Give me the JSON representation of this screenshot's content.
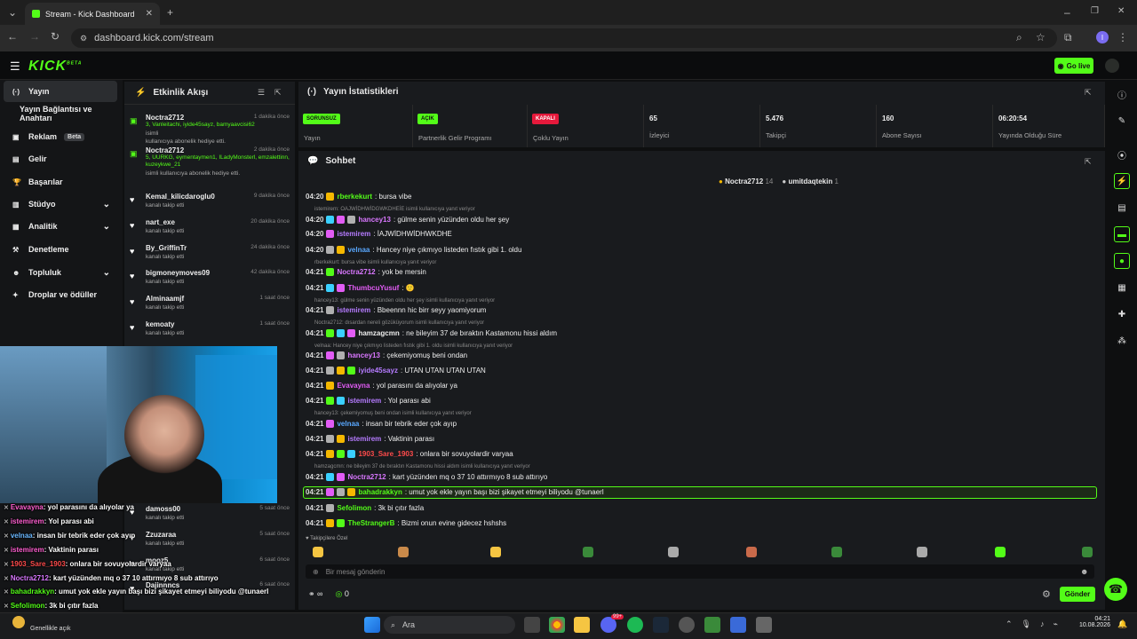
{
  "browser": {
    "tab_title": "Stream - Kick Dashboard",
    "url": "dashboard.kick.com/stream",
    "profile_initial": "I"
  },
  "app": {
    "logo": "KICK",
    "logo_sup": "BETA",
    "go_live": "Go live"
  },
  "sidebar": {
    "items": [
      {
        "label": "Yayın",
        "icon": "broadcast-icon",
        "active": true
      },
      {
        "label": "Yayın Bağlantısı ve Anahtarı"
      },
      {
        "label": "Reklam",
        "icon": "ad-icon",
        "badge": "Beta"
      },
      {
        "label": "Gelir",
        "icon": "money-icon"
      },
      {
        "label": "Başarılar",
        "icon": "trophy-icon"
      },
      {
        "label": "Stüdyo",
        "icon": "studio-icon"
      },
      {
        "label": "Analitik",
        "icon": "chart-icon"
      },
      {
        "label": "Denetleme",
        "icon": "hammer-icon"
      },
      {
        "label": "Topluluk",
        "icon": "users-icon"
      },
      {
        "label": "Droplar ve ödüller",
        "icon": "gift-icon"
      }
    ]
  },
  "feed": {
    "title": "Etkinlik Akışı",
    "items": [
      {
        "user": "Noctra2712",
        "time": "1 dakika önce",
        "green": "3, Vanleitachi, iyide45sayz, bamyaavcisi62",
        "sub": "kullanıcıya abonelik hediye etti.",
        "sub_prefix": "isimli"
      },
      {
        "user": "Noctra2712",
        "time": "2 dakika önce",
        "green": "5, UURKG, eymentaymen1, ILadyMonsterl, emzalettinn, kuzeykwe_21",
        "sub": "isimli kullanıcıya abonelik hediye etti."
      },
      {
        "user": "Kemal_kilicdaroglu0",
        "time": "9 dakika önce",
        "sub": "kanalı takip etti"
      },
      {
        "user": "nart_exe",
        "time": "20 dakika önce",
        "sub": "kanalı takip etti"
      },
      {
        "user": "By_GriffinTr",
        "time": "24 dakika önce",
        "sub": "kanalı takip etti"
      },
      {
        "user": "bigmoneymoves09",
        "time": "42 dakika önce",
        "sub": "kanalı takip etti"
      },
      {
        "user": "Alminaamjf",
        "time": "1 saat önce",
        "sub": "kanalı takip etti"
      },
      {
        "user": "kemoaty",
        "time": "1 saat önce",
        "sub": "kanalı takip etti"
      },
      {
        "user": "damoss00",
        "time": "5 saat önce",
        "sub": "kanalı takip etti"
      },
      {
        "user": "Zzuzaraa",
        "time": "5 saat önce",
        "sub": "kanalı takip etti"
      },
      {
        "user": "mooz5",
        "time": "6 saat önce",
        "sub": "kanalı takip etti"
      },
      {
        "user": "Dajinnncs",
        "time": "6 saat önce",
        "sub": ""
      }
    ]
  },
  "stats": {
    "title": "Yayın İstatistikleri",
    "cells": [
      {
        "pill": "SORUNSUZ",
        "label": "Yayın",
        "pill_color": "#53fc18"
      },
      {
        "pill": "AÇIK",
        "label": "Partnerlik Gelir Programı",
        "pill_color": "#53fc18"
      },
      {
        "pill": "KAPALI",
        "label": "Çoklu Yayın",
        "pill_color": "#e5193b"
      },
      {
        "value": "65",
        "label": "İzleyici"
      },
      {
        "value": "5.476",
        "label": "Takipçi"
      },
      {
        "value": "160",
        "label": "Abone Sayısı"
      },
      {
        "value": "06:20:54",
        "label": "Yayında Olduğu Süre"
      }
    ]
  },
  "chat": {
    "title": "Sohbet",
    "pinned": [
      {
        "user": "Noctra2712",
        "count": "14"
      },
      {
        "user": "umitdaqtekin",
        "count": "1"
      }
    ],
    "lines": [
      {
        "t": "04:20",
        "u": "rberkekurt",
        "c": "#53fc18",
        "m": ": bursa vibe"
      },
      {
        "reply": "istemirem: OAJWİDHWİDGWKDHEİE isimli kullanıcıya yanıt veriyor"
      },
      {
        "t": "04:20",
        "u": "hancey13",
        "c": "#d977ff",
        "m": ": gülme senin yüzünden oldu her şey"
      },
      {
        "t": "04:20",
        "u": "istemirem",
        "c": "#b57bff",
        "m": ": İAJWİDHWİDHWKDHE"
      },
      {
        "t": "04:20",
        "u": "velnaa",
        "c": "#59a8ff",
        "m": ": Hancey niye çıkmıyo listeden fıstık gibi 1. oldu"
      },
      {
        "reply": "rberkekurt: bursa vibe isimli kullanıcıya yanıt veriyor"
      },
      {
        "t": "04:21",
        "u": "Noctra2712",
        "c": "#d977ff",
        "m": ": yok be mersin"
      },
      {
        "t": "04:21",
        "u": "ThumbcuYusuf",
        "c": "#e25cf5",
        "m": ": 🙂"
      },
      {
        "reply": "hancey13: gülme senin yüzünden oldu her şey isimli kullanıcıya yanıt veriyor"
      },
      {
        "t": "04:21",
        "u": "istemirem",
        "c": "#b57bff",
        "m": ": Bbeennn hic birr seyy yaomiyorum"
      },
      {
        "reply": "Noctra2712: dısardan nereli gözüküyorum isimli kullanıcıya yanıt veriyor"
      },
      {
        "t": "04:21",
        "u": "hamzagcmn",
        "c": "#eeeeee",
        "m": ": ne bileyim 37 de bıraktın Kastamonu hissi aldım"
      },
      {
        "reply": "velnaa: Hancey niye çıkmıyo listeden fıstık gibi 1. oldu isimli kullanıcıya yanıt veriyor"
      },
      {
        "t": "04:21",
        "u": "hancey13",
        "c": "#d977ff",
        "m": ": çekemiyomuş beni ondan"
      },
      {
        "t": "04:21",
        "u": "iyide45sayz",
        "c": "#b57bff",
        "m": ": UTAN UTAN UTAN UTAN"
      },
      {
        "t": "04:21",
        "u": "Evavayna",
        "c": "#e25cf5",
        "m": ": yol parasını da alıyolar ya"
      },
      {
        "t": "04:21",
        "u": "istemirem",
        "c": "#b57bff",
        "m": ": Yol parası abi"
      },
      {
        "reply": "hancey13: çekemiyomuş beni ondan isimli kullanıcıya yanıt veriyor"
      },
      {
        "t": "04:21",
        "u": "velnaa",
        "c": "#59a8ff",
        "m": ": insan bir tebrik eder çok ayıp"
      },
      {
        "t": "04:21",
        "u": "istemirem",
        "c": "#b57bff",
        "m": ": Vaktinin parası"
      },
      {
        "t": "04:21",
        "u": "1903_Sare_1903",
        "c": "#ff4b4b",
        "m": ": onlara bir sovuyolardir varyaa"
      },
      {
        "reply": "hamzagcmn: ne bileyim 37 de bıraktın Kastamonu hissi aldım isimli kullanıcıya yanıt veriyor"
      },
      {
        "t": "04:21",
        "u": "Noctra2712",
        "c": "#d977ff",
        "m": ": kart yüzünden mq o 37 10 attırmıyo 8 sub attırıyo"
      },
      {
        "t": "04:21",
        "u": "bahadrakkyn",
        "c": "#53fc18",
        "m": ": umut yok ekle yayın başı bizi şikayet etmeyi biliyodu @tunaerl",
        "hl": true
      },
      {
        "t": "04:21",
        "u": "Sefolimon",
        "c": "#53fc18",
        "m": ": 3k bi çıtır fazla"
      },
      {
        "t": "04:21",
        "u": "TheStrangerB",
        "c": "#53fc18",
        "m": ": Bizmi onun evine gidecez hshshs"
      }
    ],
    "emote_label": "Takipçilere Özel",
    "placeholder": "Bir mesaj gönderin",
    "send": "Gönder",
    "points": "0",
    "infinity": "∞"
  },
  "overlay": {
    "lines": [
      {
        "u": "Evavayna",
        "c": "#ff5fd0",
        "m": ": yol parasını da alıyolar ya"
      },
      {
        "u": "istemirem",
        "c": "#ff5fd0",
        "m": ": Yol parası abi"
      },
      {
        "u": "velnaa",
        "c": "#6ab8ff",
        "m": ": insan bir tebrik eder çok ayıp"
      },
      {
        "u": "istemirem",
        "c": "#ff5fd0",
        "m": ": Vaktinin parası"
      },
      {
        "u": "1903_Sare_1903",
        "c": "#ff4b4b",
        "m": ": onlara bir sovuyolardir varyaa"
      },
      {
        "u": "Noctra2712",
        "c": "#d977ff",
        "m": ": kart yüzünden mq o 37 10 attırmıyo 8 sub attırıyo"
      },
      {
        "u": "bahadrakkyn",
        "c": "#53fc18",
        "m": ": umut yok ekle yayın başı bizi şikayet etmeyi biliyodu @tunaerl"
      },
      {
        "u": "Sefolimon",
        "c": "#53fc18",
        "m": ": 3k bi çıtır fazla"
      },
      {
        "u": "TheStrangerB",
        "c": "#53fc18",
        "m": ": Bizmi onun evine gidecez hshshs"
      }
    ]
  },
  "taskbar": {
    "search": "Ara",
    "weather": "Genellikle açık",
    "time": "04:21",
    "date": "10.08.2026",
    "badge": "99+"
  }
}
